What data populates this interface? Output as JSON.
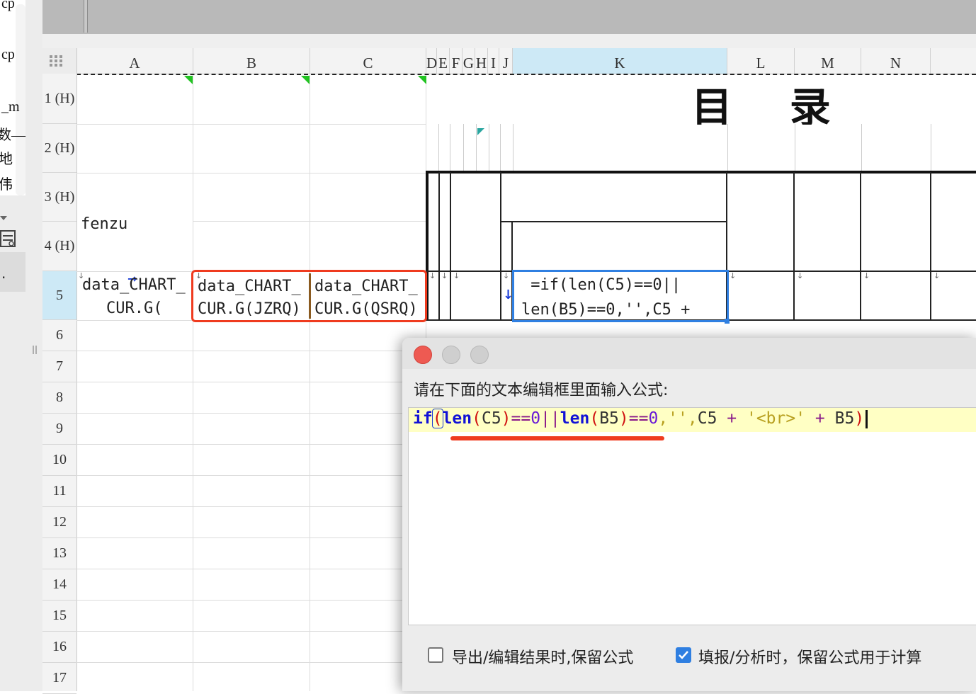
{
  "left_panel": {
    "clipped_labels": [
      "cp",
      "cp",
      "_m",
      "数—",
      "地",
      "伟"
    ],
    "icon_name": "report-list-icon",
    "selected_marker": "."
  },
  "sheet": {
    "columns": [
      "A",
      "B",
      "C",
      "D",
      "E",
      "F",
      "G",
      "H",
      "I",
      "J",
      "K",
      "L",
      "M",
      "N"
    ],
    "rows": [
      "1 (H)",
      "2 (H)",
      "3 (H)",
      "4 (H)",
      "5",
      "6",
      "7",
      "8",
      "9",
      "10",
      "11",
      "12",
      "13",
      "14",
      "15",
      "16",
      "17"
    ],
    "title": "目    录",
    "cells": {
      "a4": "fenzu",
      "a5_line1": "data_CHART_",
      "a5_line2": "CUR.G(",
      "b5_line1": "data_CHART_",
      "b5_line2": "CUR.G(JZRQ)",
      "c5_line1": "data_CHART_",
      "c5_line2": "CUR.G(QSRQ)",
      "k5_line1": " =if(len(C5)==0||",
      "k5_line2": "len(B5)==0,'',C5 +"
    },
    "highlight_color": "#ef3b1f",
    "selection_color": "#2f7fe1"
  },
  "dialog": {
    "prompt": "请在下面的文本编辑框里面输入公式:",
    "formula": {
      "t1": "if",
      "t2": "(",
      "t3": "len",
      "t4": "(",
      "t5": "C5",
      "t6": ")",
      "t7": "==",
      "t8": "0",
      "t9": "||",
      "t10": "len",
      "t11": "(",
      "t12": "B5",
      "t13": ")",
      "t14": "==",
      "t15": "0",
      "t16": ",'',",
      "t17": "C5",
      "t18": " + ",
      "t19": "'<br>'",
      "t20": " + ",
      "t21": "B5",
      "t22": ")"
    },
    "checkbox_keep_formula_export": {
      "label": "导出/编辑结果时,保留公式",
      "checked": false
    },
    "checkbox_keep_formula_fill": {
      "label": "填报/分析时，保留公式用于计算",
      "checked": true
    },
    "colors": {
      "close": "#ee5a52",
      "minimize": "#cfcfcf",
      "zoom": "#cfcfcf"
    }
  }
}
